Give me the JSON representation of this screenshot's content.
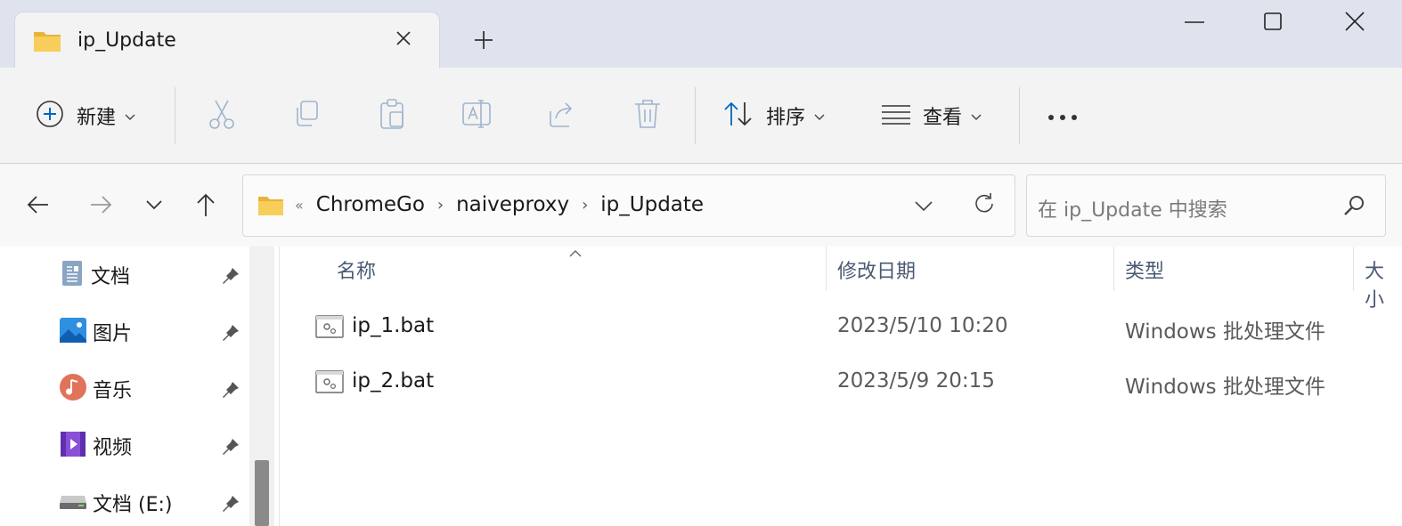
{
  "window": {
    "tab_title": "ip_Update",
    "new_tab_label": "+"
  },
  "toolbar": {
    "new_label": "新建",
    "sort_label": "排序",
    "view_label": "查看",
    "more_label": "•••"
  },
  "address": {
    "overflow": "«",
    "crumbs": [
      "ChromeGo",
      "naiveproxy",
      "ip_Update"
    ],
    "separator": "›"
  },
  "search": {
    "placeholder": "在 ip_Update 中搜索"
  },
  "sidebar": {
    "items": [
      {
        "label": "文档",
        "icon": "documents-icon"
      },
      {
        "label": "图片",
        "icon": "pictures-icon"
      },
      {
        "label": "音乐",
        "icon": "music-icon"
      },
      {
        "label": "视频",
        "icon": "videos-icon"
      },
      {
        "label": "文档 (E:)",
        "icon": "drive-icon"
      }
    ]
  },
  "columns": {
    "name": "名称",
    "modified": "修改日期",
    "type": "类型",
    "size": "大小"
  },
  "files": [
    {
      "name": "ip_1.bat",
      "modified": "2023/5/10 10:20",
      "type": "Windows 批处理文件"
    },
    {
      "name": "ip_2.bat",
      "modified": "2023/5/9 20:15",
      "type": "Windows 批处理文件"
    }
  ],
  "colors": {
    "titlebar": "#dfe3ee",
    "accent": "#0067c0",
    "folder": "#f4c64c"
  }
}
